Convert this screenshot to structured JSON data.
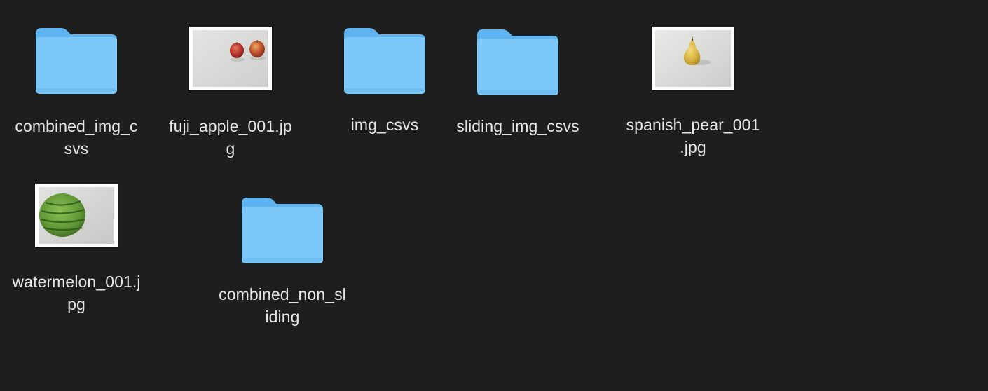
{
  "items": [
    {
      "name": "combined_img_csvs",
      "line1": "combined_img_c",
      "line2": "svs",
      "kind": "folder"
    },
    {
      "name": "fuji_apple_001.jpg",
      "line1": "fuji_apple_001.jp",
      "line2": "g",
      "kind": "image",
      "subject": "two red apples"
    },
    {
      "name": "img_csvs",
      "line1": "img_csvs",
      "line2": "",
      "kind": "folder"
    },
    {
      "name": "sliding_img_csvs",
      "line1": "sliding_img_csvs",
      "line2": "",
      "kind": "folder"
    },
    {
      "name": "spanish_pear_001.jpg",
      "line1": "spanish_pear_001",
      "line2": ".jpg",
      "kind": "image",
      "subject": "yellow pear"
    },
    {
      "name": "watermelon_001.jpg",
      "line1": "watermelon_001.j",
      "line2": "pg",
      "kind": "image",
      "subject": "striped watermelon"
    },
    {
      "name": "combined_non_sliding",
      "line1": "combined_non_sl",
      "line2": "iding",
      "kind": "folder"
    }
  ],
  "colors": {
    "background": "#1e1e1e",
    "folder_body": "#7cc8f8",
    "folder_tab": "#5fb3f0",
    "label_text": "#e6e6e6"
  }
}
